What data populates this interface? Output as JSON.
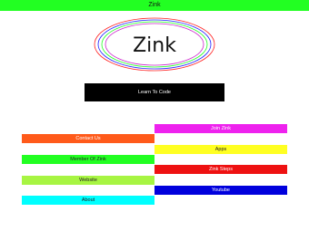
{
  "header": {
    "title": "Zink"
  },
  "logo": {
    "text": "Zink",
    "ring_colors": [
      "#ff2222",
      "#2222ff",
      "#22ff22",
      "#cc22cc"
    ]
  },
  "buttons": {
    "learn_to_code": "Learn To Code",
    "join_zink": "Join Zink",
    "contact_us": "Contact Us",
    "apps": "Apps",
    "member_of_zink": "Member Of Zink",
    "zink_steps": "Zink Steps",
    "website": "Website",
    "youtube": "Youtube",
    "about": "About"
  },
  "colors": {
    "titlebar": "#22ff22",
    "learn_to_code": "#000000",
    "join_zink": "#ee22ee",
    "contact_us": "#ff5a1a",
    "apps": "#ffff22",
    "member_of_zink": "#22ff22",
    "zink_steps": "#ee1111",
    "website": "#a7f542",
    "youtube": "#0000dd",
    "about": "#00ffff"
  }
}
